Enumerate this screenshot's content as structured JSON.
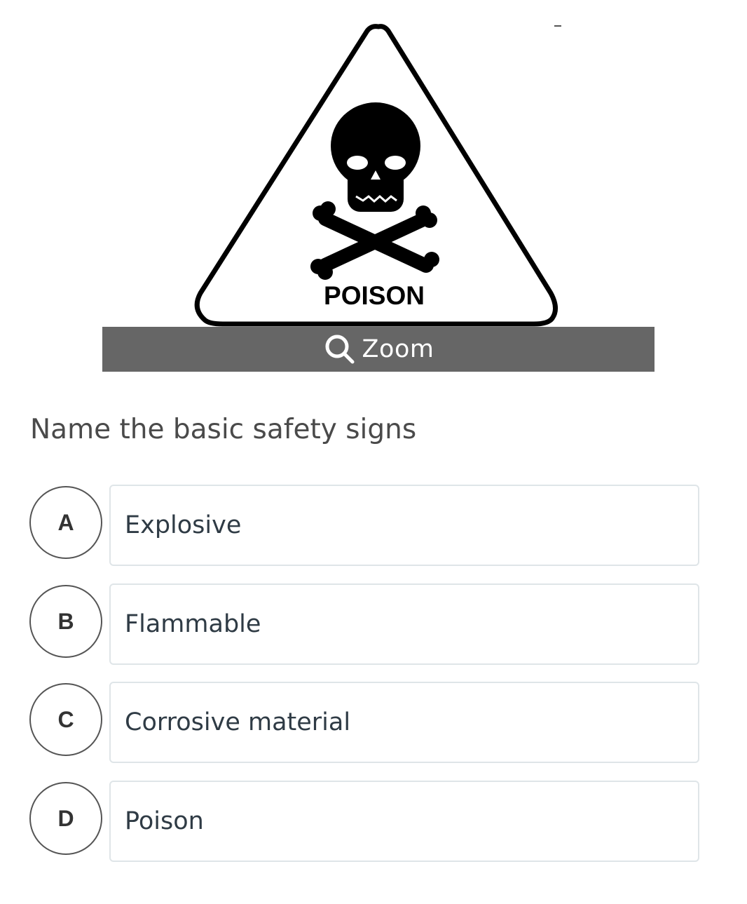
{
  "image": {
    "sign_label": "POISON",
    "zoom_label": "Zoom"
  },
  "question": {
    "text": "Name the basic safety signs"
  },
  "options": [
    {
      "letter": "A",
      "text": "Explosive"
    },
    {
      "letter": "B",
      "text": "Flammable"
    },
    {
      "letter": "C",
      "text": "Corrosive material"
    },
    {
      "letter": "D",
      "text": "Poison"
    }
  ],
  "colors": {
    "zoom_bar": "#666666",
    "option_border": "#dfe5e8",
    "letter_circle_border": "#555555"
  }
}
